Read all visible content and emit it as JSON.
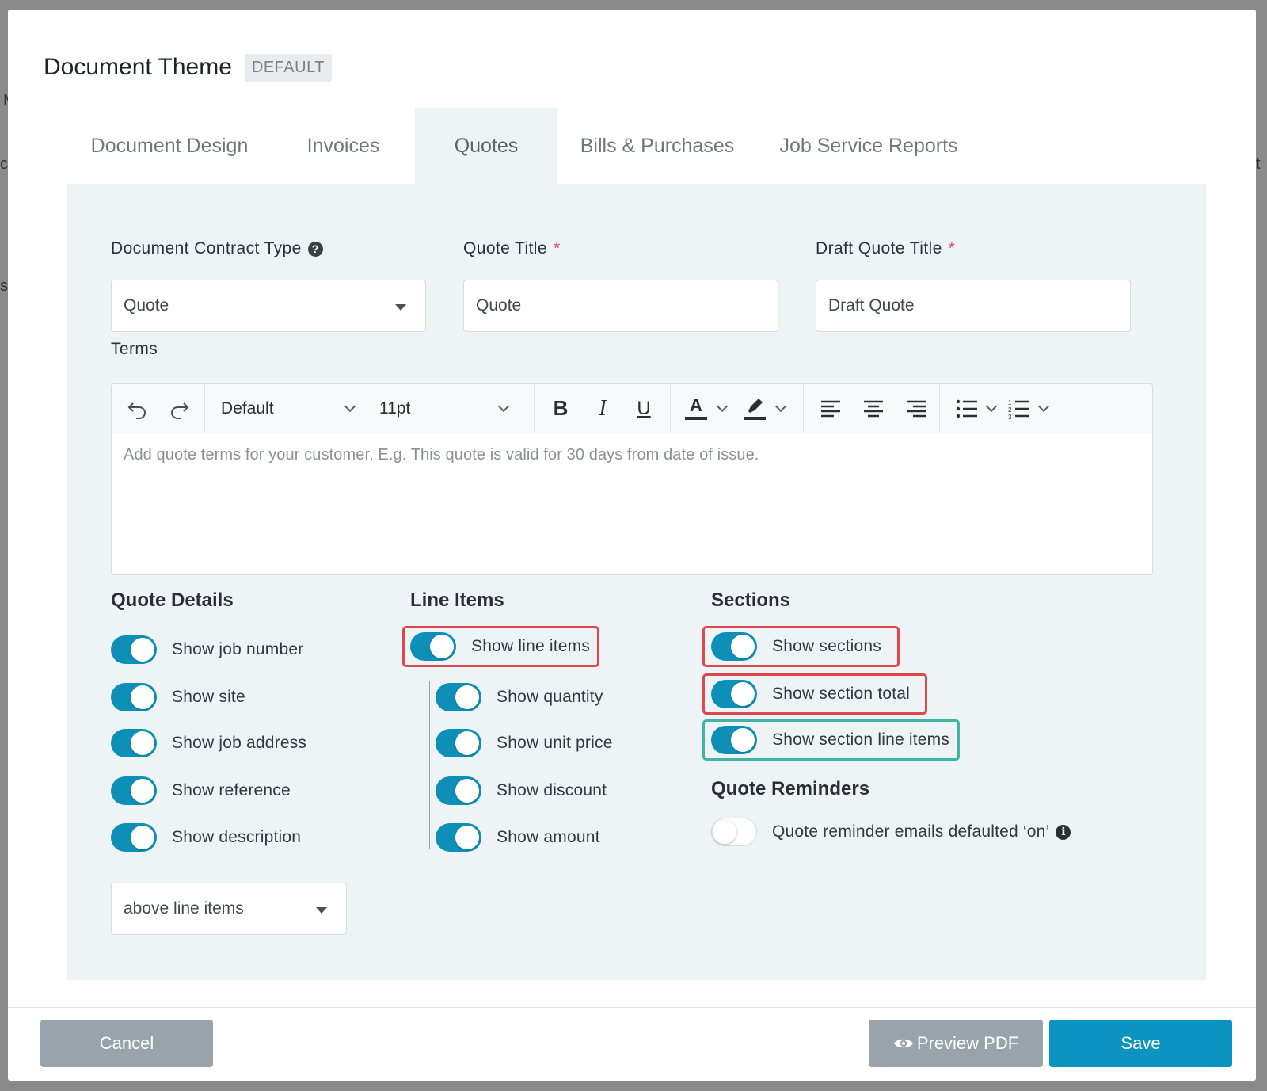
{
  "modal": {
    "title": "Document Theme",
    "badge": "DEFAULT"
  },
  "tabs": [
    {
      "label": "Document Design"
    },
    {
      "label": "Invoices"
    },
    {
      "label": "Quotes"
    },
    {
      "label": "Bills & Purchases"
    },
    {
      "label": "Job Service Reports"
    }
  ],
  "active_tab": "Quotes",
  "fields": {
    "contract_type": {
      "label": "Document Contract Type",
      "value": "Quote"
    },
    "quote_title": {
      "label": "Quote Title",
      "value": "Quote",
      "required_mark": "*"
    },
    "draft_quote_title": {
      "label": "Draft Quote Title",
      "value": "Draft Quote",
      "required_mark": "*"
    },
    "terms": {
      "label": "Terms",
      "placeholder": "Add quote terms for your customer. E.g. This quote is valid for 30 days from date of issue."
    }
  },
  "editor_toolbar": {
    "font_family": "Default",
    "font_size": "11pt",
    "bold": "B",
    "italic": "I",
    "underline": "U",
    "font_color": "A"
  },
  "quote_details": {
    "title": "Quote Details",
    "toggles": [
      {
        "label": "Show job number",
        "on": true
      },
      {
        "label": "Show site",
        "on": true
      },
      {
        "label": "Show job address",
        "on": true
      },
      {
        "label": "Show reference",
        "on": true
      },
      {
        "label": "Show description",
        "on": true
      }
    ],
    "description_position": "above line items"
  },
  "line_items": {
    "title": "Line Items",
    "main_toggle": {
      "label": "Show line items",
      "on": true
    },
    "toggles": [
      {
        "label": "Show quantity",
        "on": true
      },
      {
        "label": "Show unit price",
        "on": true
      },
      {
        "label": "Show discount",
        "on": true
      },
      {
        "label": "Show amount",
        "on": true
      }
    ]
  },
  "sections": {
    "title": "Sections",
    "toggles": [
      {
        "label": "Show sections",
        "on": true
      },
      {
        "label": "Show section total",
        "on": true
      },
      {
        "label": "Show section line items",
        "on": true
      }
    ]
  },
  "quote_reminders": {
    "title": "Quote Reminders",
    "toggle": {
      "label": "Quote reminder emails defaulted ‘on’",
      "on": false
    }
  },
  "buttons": {
    "cancel": "Cancel",
    "preview": "Preview PDF",
    "save": "Save"
  },
  "colors": {
    "primary": "#0e8fb8",
    "highlight_red": "#e0474c",
    "highlight_teal": "#3fb6a4"
  }
}
